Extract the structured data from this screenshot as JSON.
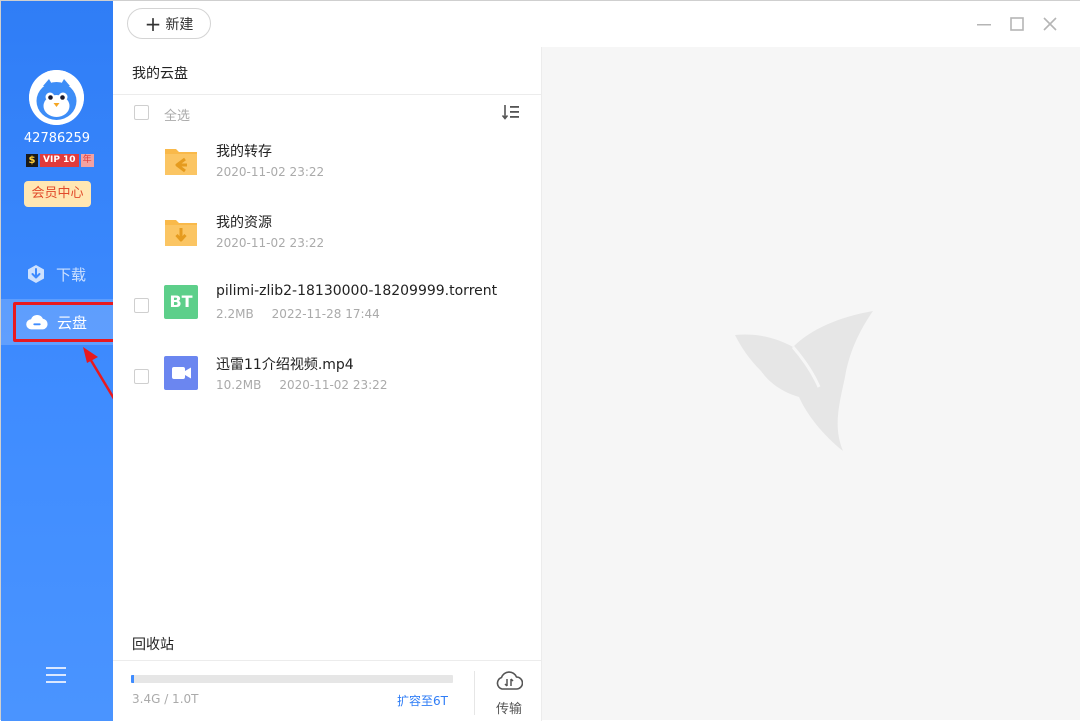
{
  "sidebar": {
    "user_id": "42786259",
    "vip": {
      "dollar": "$",
      "label": "VIP 10",
      "year": "年"
    },
    "member_center": "会员中心",
    "nav": [
      {
        "label": "下载",
        "icon": "download-icon",
        "active": false
      },
      {
        "label": "云盘",
        "icon": "cloud-icon",
        "active": true
      }
    ],
    "menu_icon": "menu-icon"
  },
  "toolbar": {
    "new_label": "新建",
    "window_controls": [
      "minimize-icon",
      "maximize-icon",
      "close-icon"
    ]
  },
  "panel": {
    "title": "我的云盘",
    "select_all": "全选",
    "files": [
      {
        "name": "我的转存",
        "size": "",
        "date": "2020-11-02 23:22",
        "type": "folder-transfer",
        "checkbox": false
      },
      {
        "name": "我的资源",
        "size": "",
        "date": "2020-11-02 23:22",
        "type": "folder-resource",
        "checkbox": false
      },
      {
        "name": "pilimi-zlib2-18130000-18209999.torrent",
        "size": "2.2MB",
        "date": "2022-11-28 17:44",
        "type": "torrent",
        "badge": "BT",
        "checkbox": true
      },
      {
        "name": "迅雷11介绍视频.mp4",
        "size": "10.2MB",
        "date": "2020-11-02 23:22",
        "type": "video",
        "checkbox": true
      }
    ],
    "recycle_bin": "回收站",
    "storage": {
      "used": "3.4G",
      "total": "1.0T",
      "text": "3.4G / 1.0T",
      "fill_fraction": 0.0034
    },
    "expand_label": "扩容至6T",
    "transfer_label": "传输"
  },
  "colors": {
    "sidebar": "#3f8cff",
    "accent": "#2f7df6",
    "folder": "#f9b94a",
    "bt_badge": "#5dcf8a",
    "video_badge": "#6b86f0",
    "highlight": "#e8191f"
  }
}
